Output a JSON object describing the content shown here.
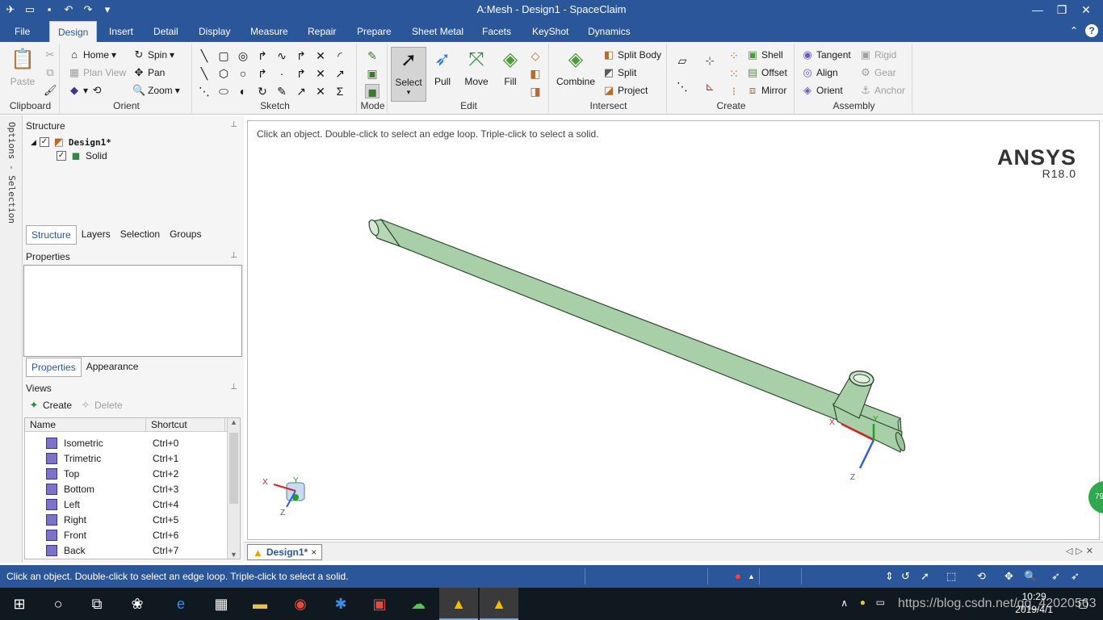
{
  "window": {
    "title": "A:Mesh - Design1 - SpaceClaim"
  },
  "tabs": [
    "File",
    "Design",
    "Insert",
    "Detail",
    "Display",
    "Measure",
    "Repair",
    "Prepare",
    "Sheet Metal",
    "Facets",
    "KeyShot",
    "Dynamics"
  ],
  "active_tab": "Design",
  "ribbon": {
    "clipboard": {
      "label": "Clipboard",
      "paste": "Paste"
    },
    "orient": {
      "label": "Orient",
      "home": "Home",
      "spin": "Spin",
      "plan_view": "Plan View",
      "pan": "Pan",
      "zoom": "Zoom"
    },
    "sketch": {
      "label": "Sketch"
    },
    "mode": {
      "label": "Mode"
    },
    "edit": {
      "label": "Edit",
      "select": "Select",
      "pull": "Pull",
      "move": "Move",
      "fill": "Fill"
    },
    "intersect": {
      "label": "Intersect",
      "combine": "Combine",
      "split_body": "Split Body",
      "split": "Split",
      "project": "Project"
    },
    "create": {
      "label": "Create",
      "shell": "Shell",
      "offset": "Offset",
      "mirror": "Mirror"
    },
    "assembly": {
      "label": "Assembly",
      "tangent": "Tangent",
      "align": "Align",
      "orient": "Orient",
      "rigid": "Rigid",
      "gear": "Gear",
      "anchor": "Anchor"
    }
  },
  "side_strip": {
    "text": "Options - Selection"
  },
  "structure": {
    "title": "Structure",
    "root": "Design1*",
    "child": "Solid",
    "tabs": [
      "Structure",
      "Layers",
      "Selection",
      "Groups"
    ]
  },
  "properties": {
    "title": "Properties",
    "tabs": [
      "Properties",
      "Appearance"
    ]
  },
  "views": {
    "title": "Views",
    "create": "Create",
    "delete": "Delete",
    "col_name": "Name",
    "col_shortcut": "Shortcut",
    "rows": [
      {
        "name": "Isometric",
        "shortcut": "Ctrl+0"
      },
      {
        "name": "Trimetric",
        "shortcut": "Ctrl+1"
      },
      {
        "name": "Top",
        "shortcut": "Ctrl+2"
      },
      {
        "name": "Bottom",
        "shortcut": "Ctrl+3"
      },
      {
        "name": "Left",
        "shortcut": "Ctrl+4"
      },
      {
        "name": "Right",
        "shortcut": "Ctrl+5"
      },
      {
        "name": "Front",
        "shortcut": "Ctrl+6"
      },
      {
        "name": "Back",
        "shortcut": "Ctrl+7"
      }
    ]
  },
  "viewport": {
    "hint": "Click an object. Double-click to select an edge loop. Triple-click to select a solid.",
    "brand": "ANSYS",
    "version": "R18.0",
    "axis_x": "X",
    "axis_y": "Y",
    "axis_z": "Z"
  },
  "doc_tab": {
    "label": "Design1*",
    "close": "×"
  },
  "status": {
    "message": "Click an object. Double-click to select an edge loop. Triple-click to select a solid."
  },
  "taskbar": {
    "time": "10:29",
    "date": "2019/4/1",
    "watermark": "https://blog.csdn.net/qq_42020563",
    "badge": "79"
  },
  "colors": {
    "accent": "#2b579a",
    "model_fill": "#a9cfa9",
    "model_stroke": "#2f4a2f"
  }
}
